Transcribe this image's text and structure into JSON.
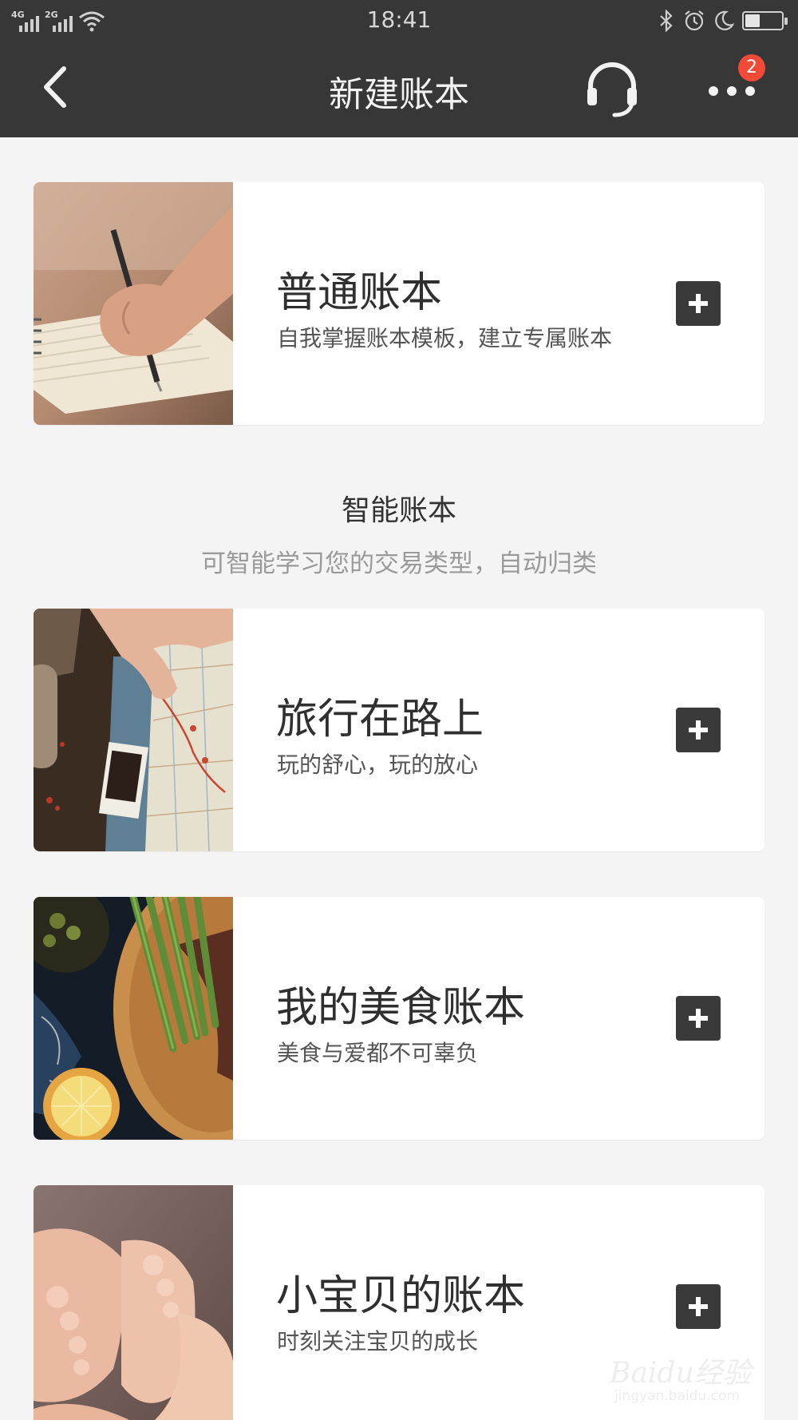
{
  "status_bar": {
    "time": "18:41",
    "network_1": "4G",
    "network_2": "2G",
    "battery_level": 0.4
  },
  "nav": {
    "title": "新建账本",
    "notification_count": "2"
  },
  "normal_book": {
    "title": "普通账本",
    "description": "自我掌握账本模板，建立专属账本",
    "image": "hand-writing-notebook"
  },
  "smart_section": {
    "title": "智能账本",
    "subtitle": "可智能学习您的交易类型，自动归类"
  },
  "smart_books": [
    {
      "title": "旅行在路上",
      "description": "玩的舒心，玩的放心",
      "image": "travel-map"
    },
    {
      "title": "我的美食账本",
      "description": "美食与爱都不可辜负",
      "image": "food-asparagus-steak"
    },
    {
      "title": "小宝贝的账本",
      "description": "时刻关注宝贝的成长",
      "image": "baby-feet"
    }
  ],
  "watermark": {
    "brand": "Baidu经验",
    "url": "jingyan.baidu.com"
  },
  "colors": {
    "header_bg": "#373737",
    "page_bg": "#f4f4f4",
    "badge": "#f24a36",
    "add_button": "#3a3a3a"
  }
}
